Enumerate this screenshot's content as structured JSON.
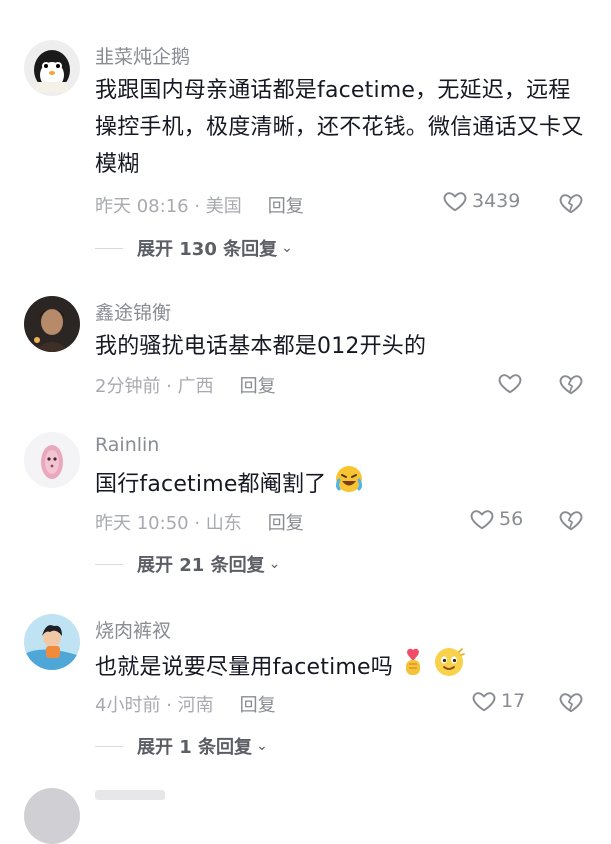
{
  "comments": [
    {
      "name": "韭菜炖企鹅",
      "text": "我跟国内母亲通话都是facetime，无延迟，远程操控手机，极度清晰，还不花钱。微信通话又卡又模糊",
      "meta": "昨天 08:16 · 美国",
      "reply": "回复",
      "likes": "3439",
      "expand": "展开 130 条回复"
    },
    {
      "name": "鑫途锦衡",
      "text": "我的骚扰电话基本都是012开头的",
      "meta": "2分钟前 · 广西",
      "reply": "回复",
      "likes": ""
    },
    {
      "name": "Rainlin",
      "text": "国行facetime都阉割了",
      "meta": "昨天 10:50 · 山东",
      "reply": "回复",
      "likes": "56",
      "expand": "展开 21 条回复"
    },
    {
      "name": "烧肉裤衩",
      "text": "也就是说要尽量用facetime吗",
      "meta": "4小时前 · 河南",
      "reply": "回复",
      "likes": "17",
      "expand": "展开 1 条回复"
    }
  ],
  "icons": {
    "like": "heart-outline-icon",
    "dislike": "broken-heart-icon",
    "expand": "chevron-down-icon"
  },
  "colors": {
    "text": "#161823",
    "secondary": "#8a8c93",
    "meta": "#a8aab0"
  }
}
